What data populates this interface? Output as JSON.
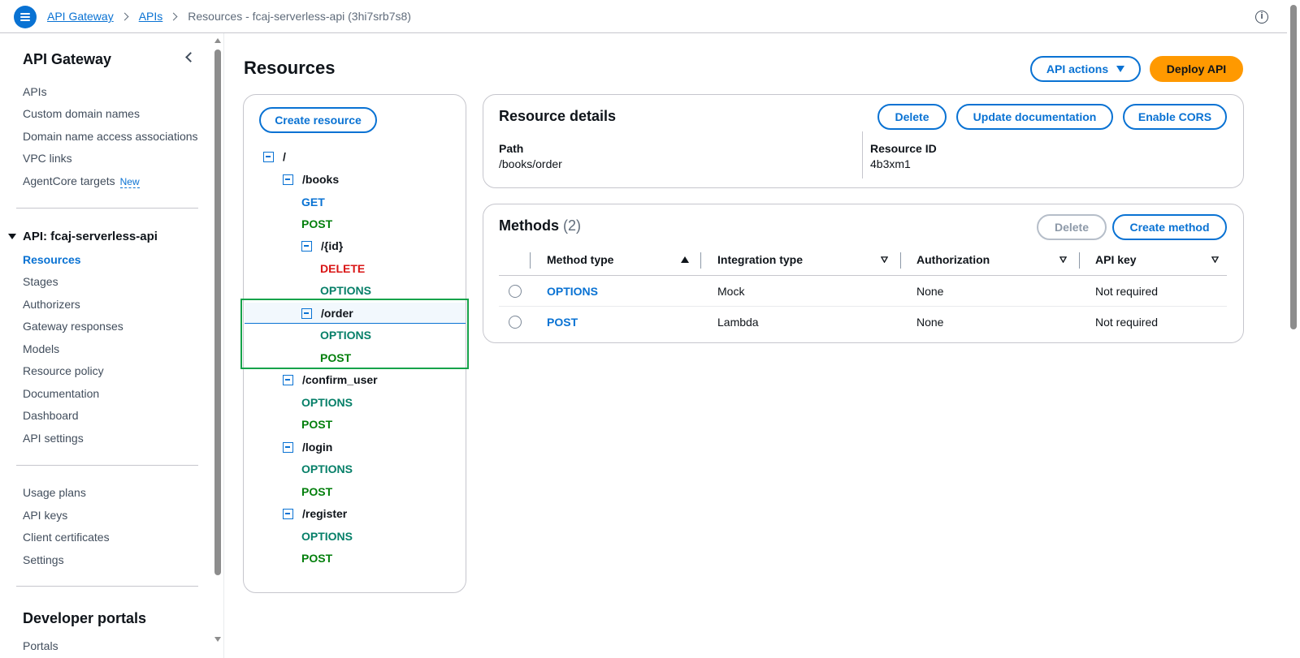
{
  "breadcrumb": {
    "items": [
      "API Gateway",
      "APIs"
    ],
    "current": "Resources - fcaj-serverless-api (3hi7srb7s8)"
  },
  "sidebar": {
    "title": "API Gateway",
    "top_links": [
      "APIs",
      "Custom domain names",
      "Domain name access associations",
      "VPC links",
      "AgentCore targets"
    ],
    "new_badge": "New",
    "api_section": "API: fcaj-serverless-api",
    "api_links": [
      "Resources",
      "Stages",
      "Authorizers",
      "Gateway responses",
      "Models",
      "Resource policy",
      "Documentation",
      "Dashboard",
      "API settings"
    ],
    "bottom_links": [
      "Usage plans",
      "API keys",
      "Client certificates",
      "Settings"
    ],
    "developer_heading": "Developer portals",
    "portals_link": "Portals"
  },
  "page": {
    "title": "Resources",
    "api_actions": "API actions",
    "deploy_api": "Deploy API",
    "create_resource": "Create resource"
  },
  "tree": [
    {
      "label": "/",
      "kind": "resource"
    },
    {
      "label": "/books",
      "kind": "resource"
    },
    {
      "label": "GET",
      "kind": "get"
    },
    {
      "label": "POST",
      "kind": "post"
    },
    {
      "label": "/{id}",
      "kind": "resource"
    },
    {
      "label": "DELETE",
      "kind": "delete"
    },
    {
      "label": "OPTIONS",
      "kind": "options"
    },
    {
      "label": "/order",
      "kind": "resource",
      "selected": true
    },
    {
      "label": "OPTIONS",
      "kind": "options"
    },
    {
      "label": "POST",
      "kind": "post"
    },
    {
      "label": "/confirm_user",
      "kind": "resource"
    },
    {
      "label": "OPTIONS",
      "kind": "options"
    },
    {
      "label": "POST",
      "kind": "post"
    },
    {
      "label": "/login",
      "kind": "resource"
    },
    {
      "label": "OPTIONS",
      "kind": "options"
    },
    {
      "label": "POST",
      "kind": "post"
    },
    {
      "label": "/register",
      "kind": "resource"
    },
    {
      "label": "OPTIONS",
      "kind": "options"
    },
    {
      "label": "POST",
      "kind": "post"
    }
  ],
  "resource_details": {
    "title": "Resource details",
    "delete": "Delete",
    "update_documentation": "Update documentation",
    "enable_cors": "Enable CORS",
    "path_label": "Path",
    "path_value": "/books/order",
    "id_label": "Resource ID",
    "id_value": "4b3xm1"
  },
  "methods": {
    "title": "Methods",
    "count": "(2)",
    "delete": "Delete",
    "create_method": "Create method",
    "columns": [
      "Method type",
      "Integration type",
      "Authorization",
      "API key"
    ],
    "rows": [
      {
        "method": "OPTIONS",
        "integration": "Mock",
        "authorization": "None",
        "api_key": "Not required"
      },
      {
        "method": "POST",
        "integration": "Lambda",
        "authorization": "None",
        "api_key": "Not required"
      }
    ]
  },
  "colors": {
    "accent": "#0972d3",
    "deploy": "#ff9900",
    "post": "#037f0c",
    "delete": "#d91515",
    "options": "#067f68",
    "highlight_box": "#16a34a"
  }
}
